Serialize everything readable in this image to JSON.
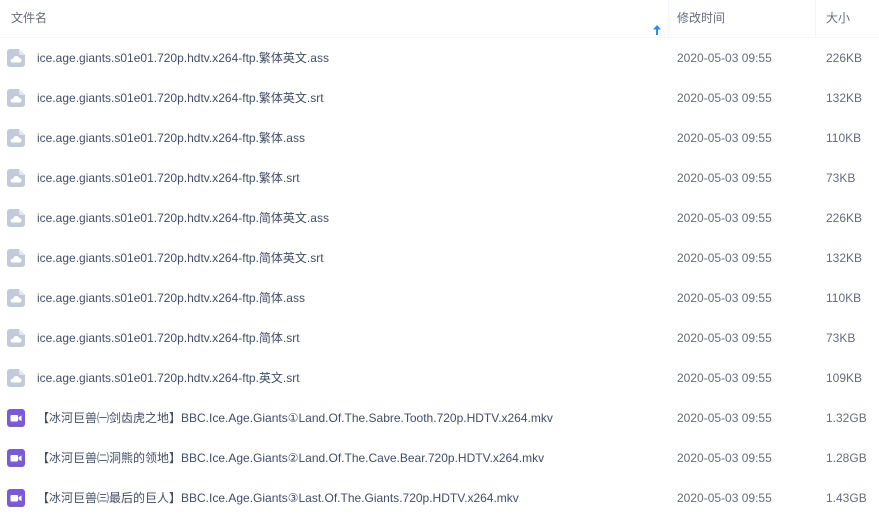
{
  "header": {
    "name_label": "文件名",
    "time_label": "修改时间",
    "size_label": "大小",
    "sort_icon": "arrow-up-icon"
  },
  "colors": {
    "sort_arrow": "#2b8bf2",
    "doc_icon": "#c3c9d6",
    "video_icon": "#7a5bd6"
  },
  "files": [
    {
      "name": "ice.age.giants.s01e01.720p.hdtv.x264-ftp.繁体英文.ass",
      "time": "2020-05-03 09:55",
      "size": "226KB",
      "icon": "cloud-document-icon"
    },
    {
      "name": "ice.age.giants.s01e01.720p.hdtv.x264-ftp.繁体英文.srt",
      "time": "2020-05-03 09:55",
      "size": "132KB",
      "icon": "cloud-document-icon"
    },
    {
      "name": "ice.age.giants.s01e01.720p.hdtv.x264-ftp.繁体.ass",
      "time": "2020-05-03 09:55",
      "size": "110KB",
      "icon": "cloud-document-icon"
    },
    {
      "name": "ice.age.giants.s01e01.720p.hdtv.x264-ftp.繁体.srt",
      "time": "2020-05-03 09:55",
      "size": "73KB",
      "icon": "cloud-document-icon"
    },
    {
      "name": "ice.age.giants.s01e01.720p.hdtv.x264-ftp.简体英文.ass",
      "time": "2020-05-03 09:55",
      "size": "226KB",
      "icon": "cloud-document-icon"
    },
    {
      "name": "ice.age.giants.s01e01.720p.hdtv.x264-ftp.简体英文.srt",
      "time": "2020-05-03 09:55",
      "size": "132KB",
      "icon": "cloud-document-icon"
    },
    {
      "name": "ice.age.giants.s01e01.720p.hdtv.x264-ftp.简体.ass",
      "time": "2020-05-03 09:55",
      "size": "110KB",
      "icon": "cloud-document-icon"
    },
    {
      "name": "ice.age.giants.s01e01.720p.hdtv.x264-ftp.简体.srt",
      "time": "2020-05-03 09:55",
      "size": "73KB",
      "icon": "cloud-document-icon"
    },
    {
      "name": "ice.age.giants.s01e01.720p.hdtv.x264-ftp.英文.srt",
      "time": "2020-05-03 09:55",
      "size": "109KB",
      "icon": "cloud-document-icon"
    },
    {
      "name": "【冰河巨兽㈠剑齿虎之地】BBC.Ice.Age.Giants①Land.Of.The.Sabre.Tooth.720p.HDTV.x264.mkv",
      "time": "2020-05-03 09:55",
      "size": "1.32GB",
      "icon": "video-file-icon"
    },
    {
      "name": "【冰河巨兽㈡洞熊的领地】BBC.Ice.Age.Giants②Land.Of.The.Cave.Bear.720p.HDTV.x264.mkv",
      "time": "2020-05-03 09:55",
      "size": "1.28GB",
      "icon": "video-file-icon"
    },
    {
      "name": "【冰河巨兽㈢最后的巨人】BBC.Ice.Age.Giants③Last.Of.The.Giants.720p.HDTV.x264.mkv",
      "time": "2020-05-03 09:55",
      "size": "1.43GB",
      "icon": "video-file-icon"
    }
  ]
}
